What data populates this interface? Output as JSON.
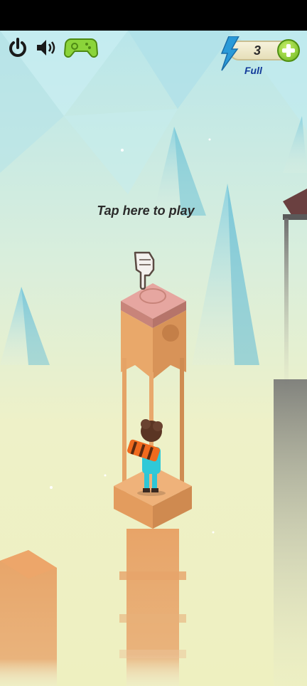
{
  "hud": {
    "icons": [
      "power-icon",
      "speaker-icon",
      "gamepad-icon",
      "lightning-icon",
      "plus-icon"
    ],
    "energy_count": "3",
    "energy_status": "Full",
    "accent_green": "#8bd43a",
    "accent_blue": "#2a9ad8"
  },
  "scene": {
    "prompt": "Tap here to play",
    "pillar_color": "#e0a06a",
    "sky_color": "#bde6e6",
    "fog_color": "#eef0c8"
  }
}
